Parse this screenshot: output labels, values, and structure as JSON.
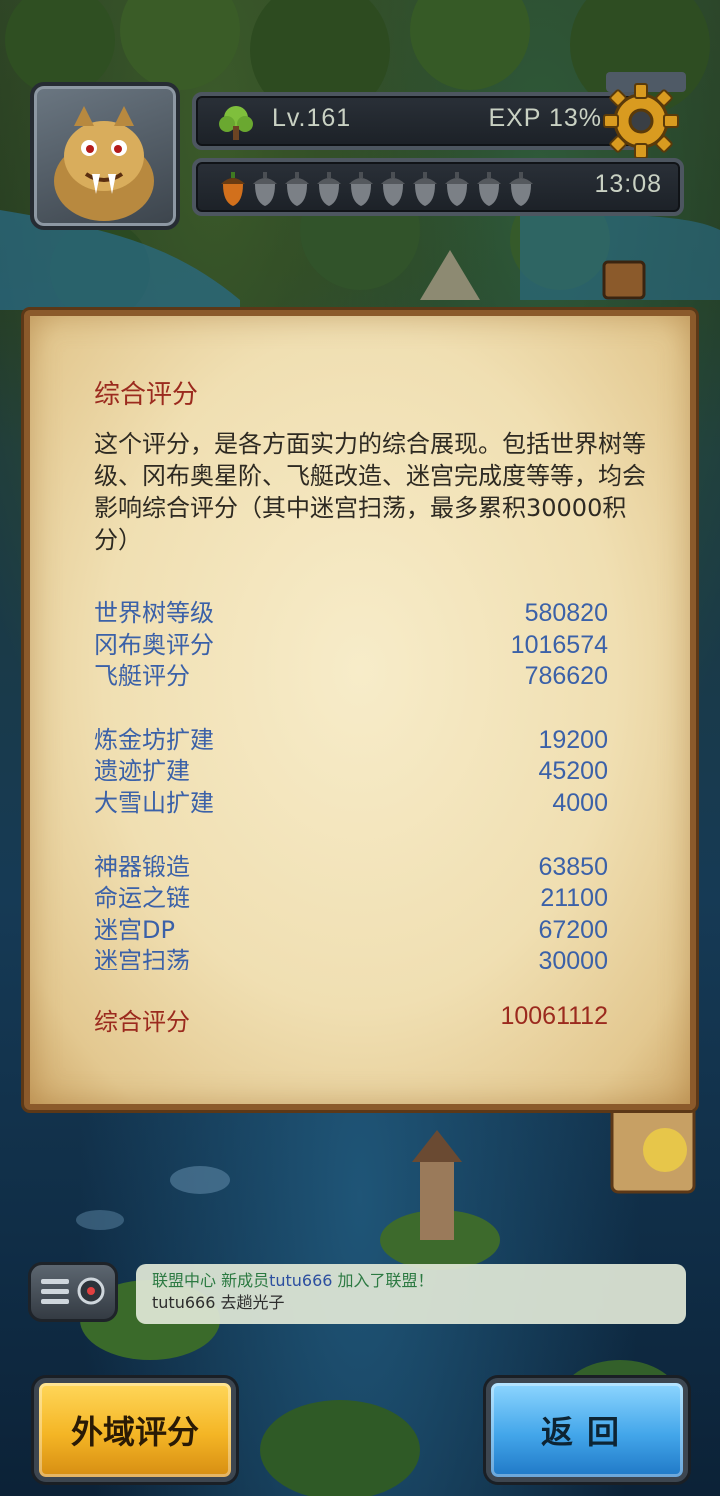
{
  "hud": {
    "level": "Lv.161",
    "exp": "EXP 13%",
    "timer": "13:08",
    "acorns_total": 10,
    "acorns_filled": 1,
    "icons": [
      "tree-icon",
      "gear-icon",
      "acorn-icon"
    ]
  },
  "panel": {
    "title": "综合评分",
    "description": "这个评分，是各方面实力的综合展现。包括世界树等级、冈布奥星阶、飞艇改造、迷宫完成度等等，均会影响综合评分（其中迷宫扫荡，最多累积30000积分）",
    "groups": [
      [
        {
          "label": "世界树等级",
          "value": "580820"
        },
        {
          "label": "冈布奥评分",
          "value": "1016574"
        },
        {
          "label": "飞艇评分",
          "value": "786620"
        }
      ],
      [
        {
          "label": "炼金坊扩建",
          "value": "19200"
        },
        {
          "label": "遗迹扩建",
          "value": "45200"
        },
        {
          "label": "大雪山扩建",
          "value": "4000"
        }
      ],
      [
        {
          "label": "神器锻造",
          "value": "63850"
        },
        {
          "label": "命运之链",
          "value": "21100"
        },
        {
          "label": "迷宫DP",
          "value": "67200"
        },
        {
          "label": "迷宫扫荡",
          "value": "30000"
        }
      ]
    ],
    "total_label": "综合评分",
    "total_value": "10061112"
  },
  "chat": {
    "line1_prefix": "联盟中心  新成员",
    "line1_name": "tutu666",
    "line1_suffix": " 加入了联盟！",
    "line2": "tutu666  去趟光子"
  },
  "buttons": {
    "outer_score": "外域评分",
    "back": "返回"
  },
  "colors": {
    "accent_red": "#9b2a1e",
    "score_blue": "#3b61a8",
    "parchment": "#f0dfb2"
  }
}
